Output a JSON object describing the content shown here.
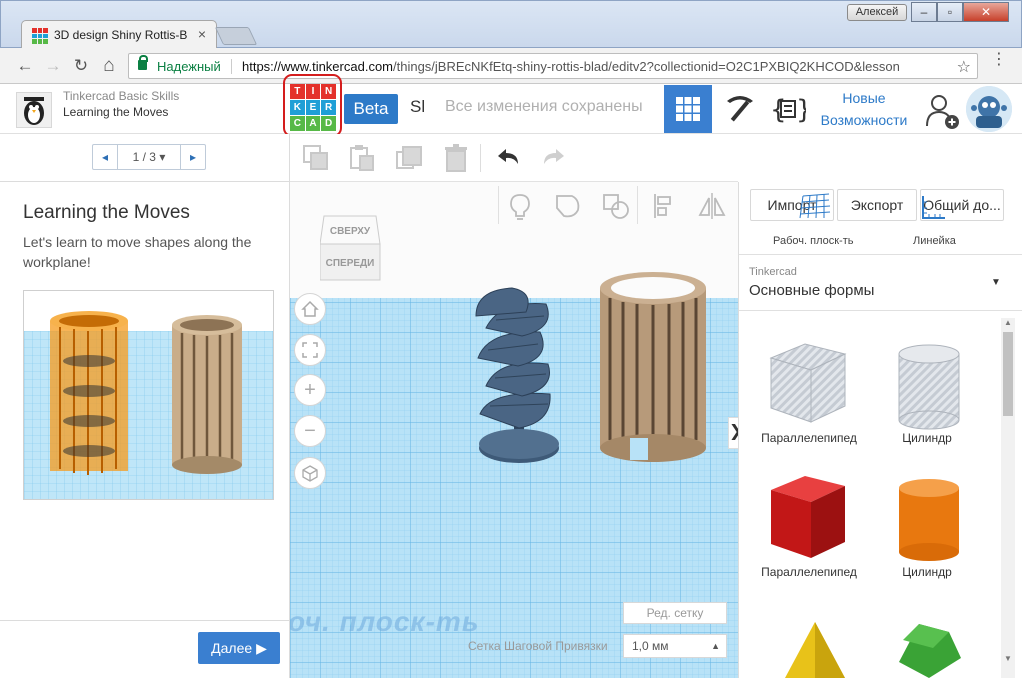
{
  "browser": {
    "tab_title": "3D design Shiny Rottis-B",
    "tab_close": "×",
    "user_name": "Алексей",
    "win_min": "–",
    "win_max": "▫",
    "win_close": "✕",
    "secure_label": "Надежный",
    "url_host": "https://www.tinkercad.com",
    "url_path": "/things/jBREcNKfEtq-shiny-rottis-blad/editv2?collectionid=O2C1PXBIQ2KHCOD&lesson",
    "star": "☆",
    "menu": "⋮",
    "back": "←",
    "forward": "→",
    "reload": "↻",
    "home": "⌂"
  },
  "lesson": {
    "course": "Tinkercad Basic Skills",
    "name": "Learning the Moves",
    "page": "1 / 3",
    "page_caret": "▾",
    "prev": "◂",
    "next": "▸",
    "title": "Learning the Moves",
    "description": "Let's learn to move shapes along the workplane!",
    "next_button": "Далее",
    "next_arrow": "▶"
  },
  "header": {
    "logo_letters": [
      "T",
      "I",
      "N",
      "K",
      "E",
      "R",
      "C",
      "A",
      "D"
    ],
    "logo_colors": [
      "#e4312b",
      "#e4312b",
      "#e4312b",
      "#1f9fd6",
      "#1f9fd6",
      "#1f9fd6",
      "#57b947",
      "#57b947",
      "#57b947"
    ],
    "beta": "Beta",
    "design_name": "Sl",
    "saved_status": "Все изменения сохранены",
    "new_features_line1": "Новые",
    "new_features_line2": "Возможности"
  },
  "viewport": {
    "cube_top": "СВЕРХУ",
    "cube_front": "СПЕРЕДИ",
    "collapse": "❯",
    "workplane_label": "оч. плоск-ть",
    "edit_grid": "Ред. сетку",
    "snap_label": "Сетка Шаговой Привязки",
    "snap_value": "1,0 мм",
    "snap_caret": "▲"
  },
  "rightpanel": {
    "import": "Импорт",
    "export": "Экспорт",
    "share": "Общий до...",
    "workplane": "Рабоч. плоск-ть",
    "ruler": "Линейка",
    "library_source": "Tinkercad",
    "library_name": "Основные формы",
    "library_caret": "▼",
    "shapes": [
      {
        "label": "Параллелепипед"
      },
      {
        "label": "Цилиндр"
      },
      {
        "label": "Параллелепипед"
      },
      {
        "label": "Цилиндр"
      }
    ],
    "scroll_up": "▲",
    "scroll_down": "▼"
  },
  "colors": {
    "accent": "#3a7fd0",
    "workplane": "#a9dbf5",
    "box_red": "#d21e1e",
    "cyl_orange": "#ea7a14"
  }
}
